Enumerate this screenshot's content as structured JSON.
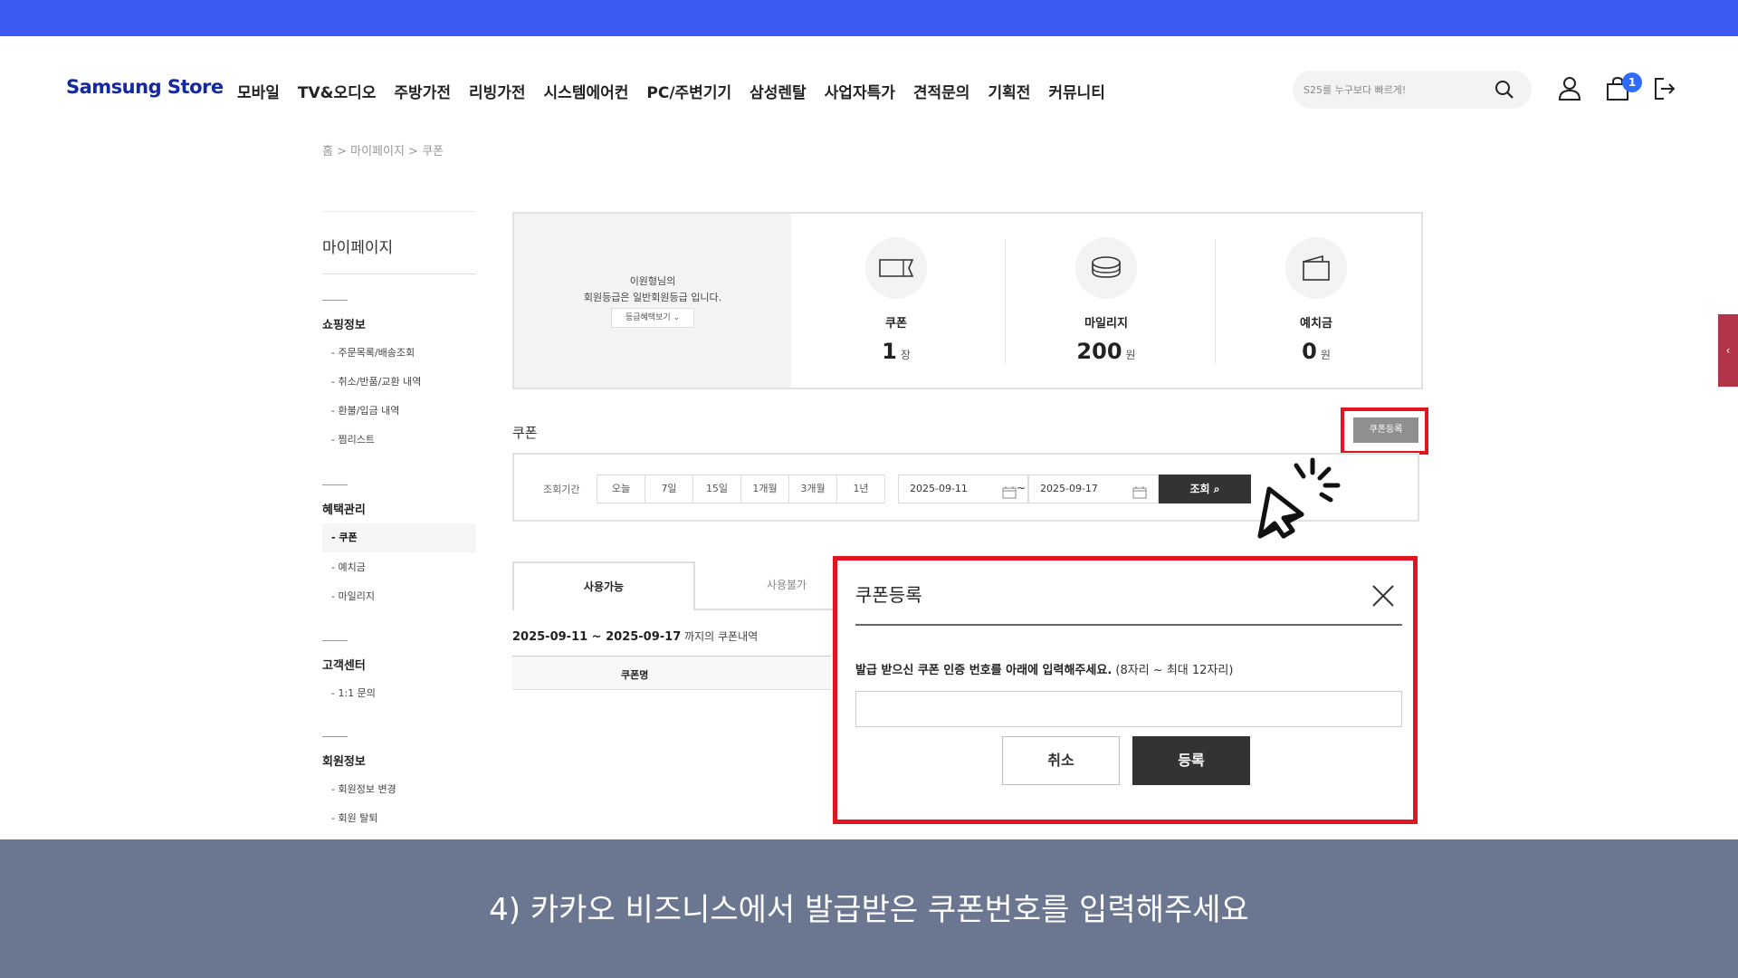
{
  "header": {
    "logo_main": "Samsung",
    "logo_sub": "Store",
    "nav": [
      "모바일",
      "TV&오디오",
      "주방가전",
      "리빙가전",
      "시스템에어컨",
      "PC/주변기기",
      "삼성렌탈",
      "사업자특가",
      "견적문의",
      "기획전",
      "커뮤니티"
    ],
    "search_placeholder": "S25를 누구보다 빠르게!",
    "cart_count": "1"
  },
  "breadcrumb": "홈 > 마이페이지 > 쿠폰",
  "sidebar": {
    "title": "마이페이지",
    "sections": [
      {
        "heading": "쇼핑정보",
        "items": [
          "- 주문목록/배송조회",
          "- 취소/반품/교환 내역",
          "- 환불/입금 내역",
          "- 찜리스트"
        ]
      },
      {
        "heading": "혜택관리",
        "items": [
          "- 쿠폰",
          "- 예치금",
          "- 마일리지"
        ]
      },
      {
        "heading": "고객센터",
        "items": [
          "- 1:1 문의"
        ]
      },
      {
        "heading": "회원정보",
        "items": [
          "- 회원정보 변경",
          "- 회원 탈퇴"
        ]
      }
    ]
  },
  "summary": {
    "member_line1": "이원형님의",
    "member_line2": "회원등급은 일반회원등급 입니다.",
    "grade_button": "등급혜택보기 ⌄",
    "stats": [
      {
        "label": "쿠폰",
        "value": "1",
        "unit": "장"
      },
      {
        "label": "마일리지",
        "value": "200",
        "unit": "원"
      },
      {
        "label": "예치금",
        "value": "0",
        "unit": "원"
      }
    ]
  },
  "coupon": {
    "section_title": "쿠폰",
    "register_button": "쿠폰등록",
    "filter_label": "조회기간",
    "periods": [
      "오늘",
      "7일",
      "15일",
      "1개월",
      "3개월",
      "1년"
    ],
    "date_from": "2025-09-11",
    "date_to": "2025-09-17",
    "dash": "~",
    "search_button": "조회",
    "tabs": [
      "사용가능",
      "사용불가"
    ],
    "range_bold": "2025-09-11 ~ 2025-09-17",
    "range_suffix": " 까지의 쿠폰내역",
    "col_name": "쿠폰명"
  },
  "modal": {
    "title": "쿠폰등록",
    "desc_bold": "발급 받으신 쿠폰 인증 번호를 아래에 입력해주세요.",
    "desc_note": " (8자리 ~ 최대 12자리)",
    "input_value": "",
    "cancel": "취소",
    "confirm": "등록"
  },
  "caption": "4) 카카오 비즈니스에서 발급받은 쿠폰번호를 입력해주세요",
  "colors": {
    "top_bar": "#3d5af1",
    "highlight": "#e0151f",
    "caption_bg": "#6b7791",
    "badge": "#2f6bff"
  }
}
